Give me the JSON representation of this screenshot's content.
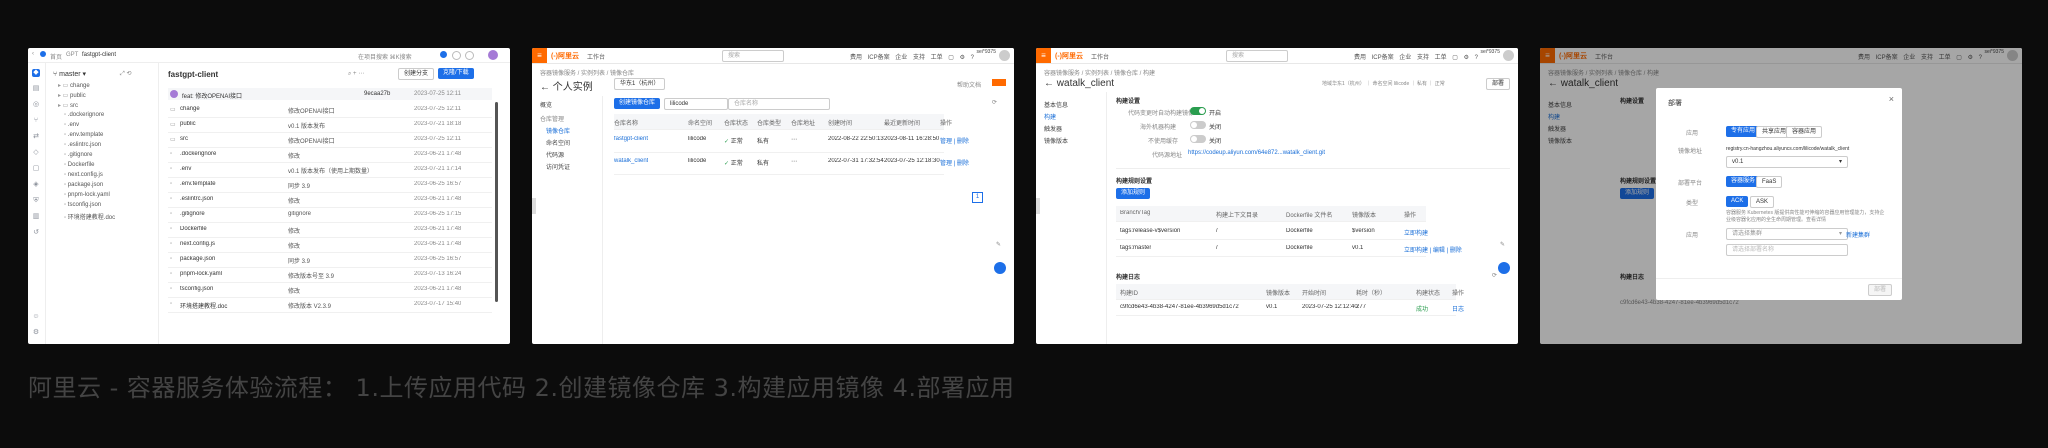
{
  "caption": "阿里云 - 容器服务体验流程： 1.上传应用代码 2.创建镜像仓库 3.构建应用镜像 4.部署应用",
  "colors": {
    "aliyun_orange": "#ff6a00",
    "primary_blue": "#1d6fe8",
    "success_green": "#2a9d4f"
  },
  "s1": {
    "crumb_home": "首页",
    "crumb_gpt": "GPT",
    "repo": "fastgpt-client",
    "search_placeholder": "在项目搜索 ⌘K搜索",
    "branch": "master",
    "repo_title": "fastgpt-client",
    "btn_new_branch": "创建分支",
    "btn_clone": "克隆/下载",
    "commit_msg": "feat: 修改OPENAI接口",
    "commit_hash": "9ecaa27b",
    "commit_date": "2023-07-25 12:11",
    "tree": [
      "change",
      "public",
      "src",
      ".dockerignore",
      ".env",
      ".env.template",
      ".eslintrc.json",
      ".gitignore",
      "Dockerfile",
      "next.config.js",
      "package.json",
      "pnpm-lock.yaml",
      "tsconfig.json",
      "环境搭建教程.doc"
    ],
    "files": [
      {
        "name": "change",
        "msg": "修改OPENAI接口",
        "date": "2023-07-25 12:11"
      },
      {
        "name": "public",
        "msg": "v0.1 版本发布",
        "date": "2023-07-21 18:18"
      },
      {
        "name": "src",
        "msg": "修改OPENAI接口",
        "date": "2023-07-25 12:11"
      },
      {
        "name": ".dockerignore",
        "msg": "修改",
        "date": "2023-06-21 17:48"
      },
      {
        "name": ".env",
        "msg": "v0.1 版本发布（使用上期数量）",
        "date": "2023-07-21 17:14"
      },
      {
        "name": ".env.template",
        "msg": "同步 3.9",
        "date": "2023-06-25 16:57"
      },
      {
        "name": ".eslintrc.json",
        "msg": "修改",
        "date": "2023-06-21 17:48"
      },
      {
        "name": ".gitignore",
        "msg": "gitignore",
        "date": "2023-06-25 17:15"
      },
      {
        "name": "Dockerfile",
        "msg": "修改",
        "date": "2023-06-21 17:48"
      },
      {
        "name": "next.config.js",
        "msg": "修改",
        "date": "2023-06-21 17:48"
      },
      {
        "name": "package.json",
        "msg": "同步 3.9",
        "date": "2023-06-25 16:57"
      },
      {
        "name": "pnpm-lock.yaml",
        "msg": "修改版本号至 3.9",
        "date": "2023-07-13 16:24"
      },
      {
        "name": "tsconfig.json",
        "msg": "修改",
        "date": "2023-06-21 17:48"
      },
      {
        "name": "环境搭建教程.doc",
        "msg": "修改版本 V2.3.9",
        "date": "2023-07-17 15:40"
      }
    ]
  },
  "s2": {
    "logo": "(-)阿里云",
    "workspace": "工作台",
    "search_placeholder": "搜索",
    "topnav": "费用 ICP备案 企业 支持 工单 ▢ ⚙ ?",
    "user": "sei*9375",
    "crumb": "容器镜像服务 / 实例列表 / 镜像仓库",
    "title": "个人实例",
    "region": "华东1（杭州）",
    "help": "帮助文档",
    "leftnav": [
      "概览",
      "仓库管理",
      "镜像仓库",
      "命名空间",
      "代码源",
      "访问凭证"
    ],
    "btn_create": "创建镜像仓库",
    "filter": "lilicode",
    "search_repo": "仓库名称",
    "columns": [
      "仓库名称",
      "命名空间",
      "仓库状态",
      "仓库类型",
      "仓库地址",
      "创建时间",
      "最近更新时间",
      "操作"
    ],
    "rows": [
      {
        "name": "fastgpt-client",
        "ns": "lilicode",
        "status": "正常",
        "type": "私有",
        "created": "2022-08-22 22:50:13",
        "updated": "2023-08-11 16:28:50",
        "ops": "管理 | 删除"
      },
      {
        "name": "watalk_client",
        "ns": "lilicode",
        "status": "正常",
        "type": "私有",
        "created": "2022-07-31 17:32:54",
        "updated": "2023-07-25 12:18:30",
        "ops": "管理 | 删除"
      }
    ],
    "page": "1"
  },
  "s3": {
    "crumb": "容器镜像服务 / 实例列表 / 镜像仓库 / 构建",
    "title": "watalk_client",
    "meta": "地域华东1（杭州） ｜ 命名空间 lilicode ｜ 私有 ｜ 正常",
    "btn_deploy": "部署",
    "leftnav": [
      "基本信息",
      "构建",
      "触发器",
      "镜像版本"
    ],
    "sec_settings": "构建设置",
    "opt1": "代码变更时自动构建镜像",
    "opt2": "海外机器构建",
    "opt3": "不使用缓存",
    "opt_on": "开启",
    "opt_off": "关闭",
    "code_src_label": "代码源地址",
    "code_src": "https://codeup.aliyun.com/64e872...watalk_client.git",
    "sec_rules": "构建规则设置",
    "btn_add_rule": "添加规则",
    "rule_cols": [
      "Branch/Tag",
      "构建上下文目录",
      "Dockerfile 文件名",
      "镜像版本",
      "操作"
    ],
    "rules": [
      {
        "tag": "tags:release-v$version",
        "dir": "/",
        "file": "Dockerfile",
        "ver": "$version",
        "ops": "立即构建"
      },
      {
        "tag": "tags:master",
        "dir": "/",
        "file": "Dockerfile",
        "ver": "v0.1",
        "ops": "立即构建 | 编辑 | 删除"
      }
    ],
    "sec_log": "构建日志",
    "log_cols": [
      "构建ID",
      "镜像版本",
      "开始时间",
      "耗时（秒）",
      "构建状态",
      "操作"
    ],
    "log": {
      "id": "c9fcd6e43-4b38-4247-81ee-4b3969d5d1c72",
      "ver": "v0.1",
      "start": "2023-07-25 12:12:40",
      "dur": "277",
      "status": "成功",
      "op": "日志"
    }
  },
  "s4": {
    "modal_title": "部署",
    "close": "×",
    "label_app": "应用",
    "tabs_app": [
      "专有应用",
      "共享应用",
      "容器应用"
    ],
    "label_image": "镜像地址",
    "image": "registry.cn-hangzhou.aliyuncs.com/lilicode/watalk_client",
    "version": "v0.1",
    "label_platform": "部署平台",
    "platforms": [
      "容器服务",
      "FaaS"
    ],
    "label_type": "类型",
    "types": [
      "ACK",
      "ASK"
    ],
    "type_desc": "容器服务 Kubernetes 版提供高性能可伸缩的容器应用管理能力，支持企业级容器化应用的全生命周期管理。查看详情",
    "label_cluster": "应用",
    "cluster_placeholder": "请选择集群",
    "new_cluster": "新建集群",
    "deploy_placeholder": "请选择部署名称",
    "btn_confirm": "部署"
  }
}
